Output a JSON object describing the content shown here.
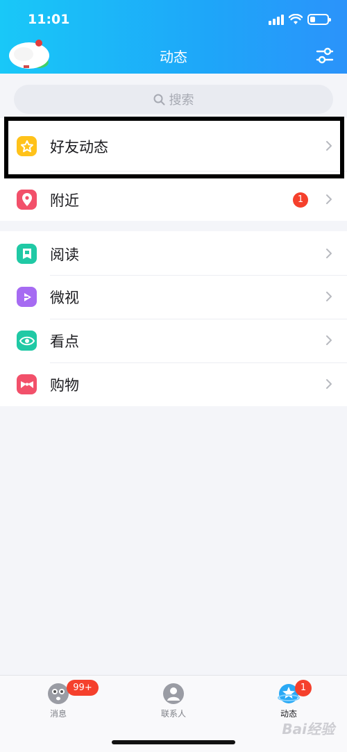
{
  "status_bar": {
    "time": "11:01"
  },
  "header": {
    "title": "动态"
  },
  "search": {
    "placeholder": "搜索"
  },
  "group1": [
    {
      "label": "好友动态",
      "icon": "star-icon",
      "color": "#ffc21a"
    },
    {
      "label": "附近",
      "icon": "location-pin-icon",
      "color": "#f2506a",
      "badge": "1"
    }
  ],
  "group2": [
    {
      "label": "阅读",
      "icon": "book-icon",
      "color": "#20c9a5"
    },
    {
      "label": "微视",
      "icon": "play-icon",
      "color": "#a66bf2"
    },
    {
      "label": "看点",
      "icon": "eye-icon",
      "color": "#20c9a5"
    },
    {
      "label": "购物",
      "icon": "bow-icon",
      "color": "#f2506a"
    }
  ],
  "tabbar": {
    "tabs": [
      {
        "label": "消息",
        "icon": "chat-face-icon"
      },
      {
        "label": "联系人",
        "icon": "contact-person-icon"
      },
      {
        "label": "动态",
        "icon": "planet-star-icon",
        "active": true
      }
    ],
    "msg_badge": "99+",
    "dyn_badge": "1"
  },
  "colors": {
    "header_start": "#19c8f8",
    "header_end": "#2b93fa",
    "badge": "#f5402c"
  },
  "watermark": "Bai经验"
}
